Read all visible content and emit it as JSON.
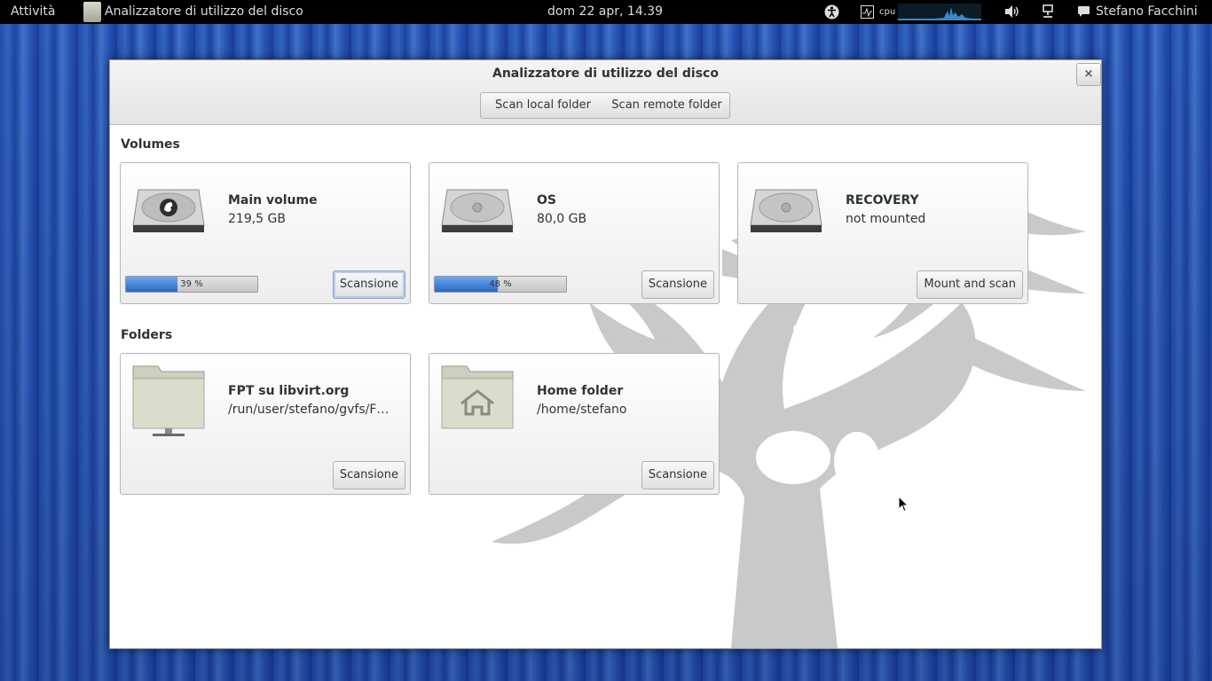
{
  "topbar": {
    "activities": "Attività",
    "app_name": "Analizzatore di utilizzo del disco",
    "clock": "dom 22 apr, 14.39",
    "cpu_label": "cpu",
    "user": "Stefano Facchini"
  },
  "window": {
    "title": "Analizzatore di utilizzo del disco",
    "close": "×",
    "scan_local": "Scan local folder",
    "scan_remote": "Scan remote folder"
  },
  "sections": {
    "volumes": "Volumes",
    "folders": "Folders"
  },
  "volumes": [
    {
      "name": "Main volume",
      "size": "219,5 GB",
      "usage_percent": 39,
      "usage_label": "39 %",
      "button": "Scansione",
      "icon": "harddisk-gnome-icon"
    },
    {
      "name": "OS",
      "size": "80,0 GB",
      "usage_percent": 48,
      "usage_label": "48 %",
      "button": "Scansione",
      "icon": "harddisk-icon"
    },
    {
      "name": "RECOVERY",
      "size": "not mounted",
      "button": "Mount and scan",
      "icon": "harddisk-icon"
    }
  ],
  "folders": [
    {
      "name": "FPT su libvirt.org",
      "path": "/run/user/stefano/gvfs/F…",
      "button": "Scansione",
      "icon": "network-folder-icon"
    },
    {
      "name": "Home folder",
      "path": "/home/stefano",
      "button": "Scansione",
      "icon": "home-folder-icon"
    }
  ],
  "colors": {
    "accent": "#2868c6",
    "desktop": "#2a5bc0",
    "tree": "#c8c8c8"
  }
}
